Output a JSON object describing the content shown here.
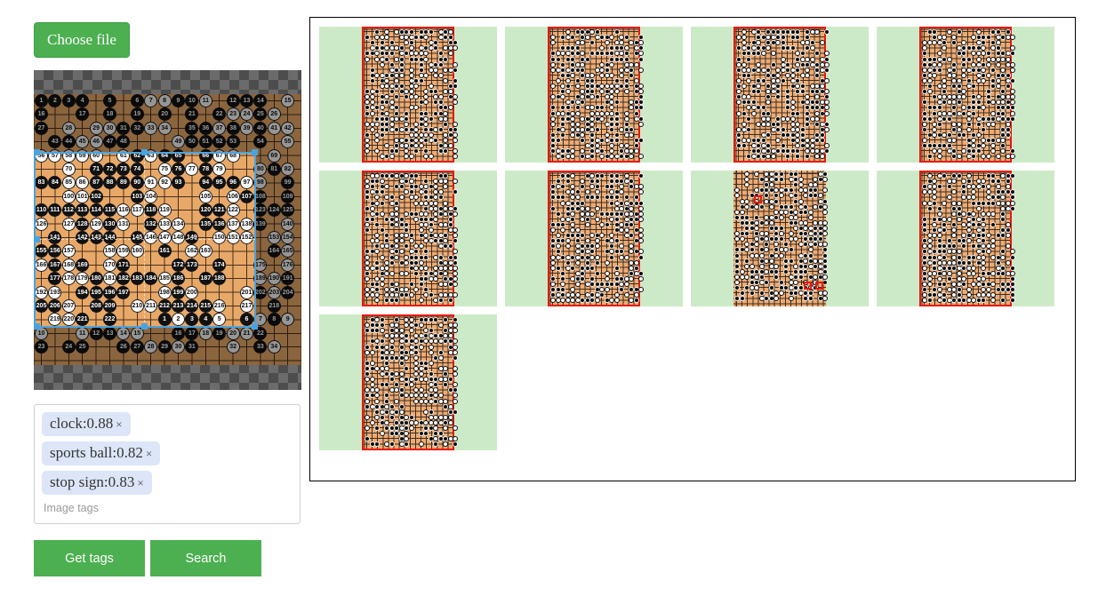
{
  "app": {
    "background": "#ffffff"
  },
  "left_panel": {
    "choose_file_button": {
      "label": "Choose file",
      "color": "#4caf50"
    },
    "preview": {
      "name": "image-preview",
      "alt": "Go game record board with numbered stones",
      "crop_overlay": true
    },
    "tags_box": {
      "placeholder": "Image tags",
      "chip_color": "#dce6f8",
      "tags": [
        {
          "label": "clock:0.88",
          "name": "clock",
          "score": "0.88",
          "remove": "×"
        },
        {
          "label": "sports ball:0.82",
          "name": "sports ball",
          "score": "0.82",
          "remove": "×"
        },
        {
          "label": "stop sign:0.83",
          "name": "stop sign",
          "score": "0.83",
          "remove": "×"
        }
      ]
    },
    "actions": [
      {
        "label": "Get tags",
        "name": "get-tags-button"
      },
      {
        "label": "Search",
        "name": "search-button"
      }
    ]
  },
  "results": {
    "panel_border": "#000000",
    "thumb_bg": "#cdeac8",
    "board_bg": "#edab73",
    "marker_color": "#e8190f",
    "items": [
      {
        "id": 1,
        "highlight": "border",
        "markers": []
      },
      {
        "id": 2,
        "highlight": "border",
        "markers": []
      },
      {
        "id": 3,
        "highlight": "border",
        "markers": []
      },
      {
        "id": 4,
        "highlight": "border",
        "markers": []
      },
      {
        "id": 5,
        "highlight": "border",
        "markers": []
      },
      {
        "id": 6,
        "highlight": "border",
        "markers": []
      },
      {
        "id": 7,
        "highlight": "markers",
        "markers": [
          {
            "x": 22,
            "y": 18
          },
          {
            "x": 76,
            "y": 82
          },
          {
            "x": 88,
            "y": 82
          }
        ]
      },
      {
        "id": 8,
        "highlight": "border",
        "markers": []
      },
      {
        "id": 9,
        "highlight": "border",
        "markers": []
      }
    ]
  }
}
